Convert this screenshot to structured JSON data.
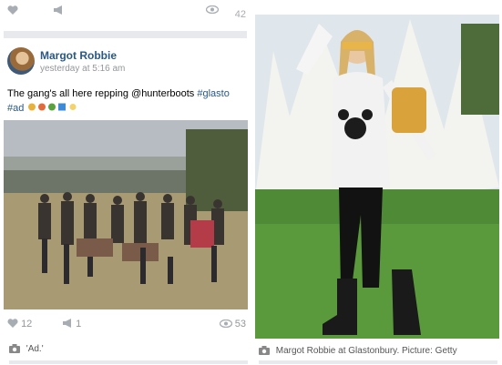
{
  "top_post": {
    "views": "42"
  },
  "post": {
    "author": "Margot Robbie",
    "time": "yesterday at 5:16 am",
    "text": "The gang's all here repping @hunterboots",
    "hashtag_glasto": "#glasto",
    "hashtag_ad": "#ad",
    "likes": "12",
    "shares": "1",
    "views": "53"
  },
  "captions": {
    "left": "'Ad.'",
    "right": "Margot Robbie at Glastonbury. Picture: Getty"
  },
  "colors": {
    "link": "#2a5885",
    "icon": "#939699",
    "divider": "#e8e9ec"
  }
}
